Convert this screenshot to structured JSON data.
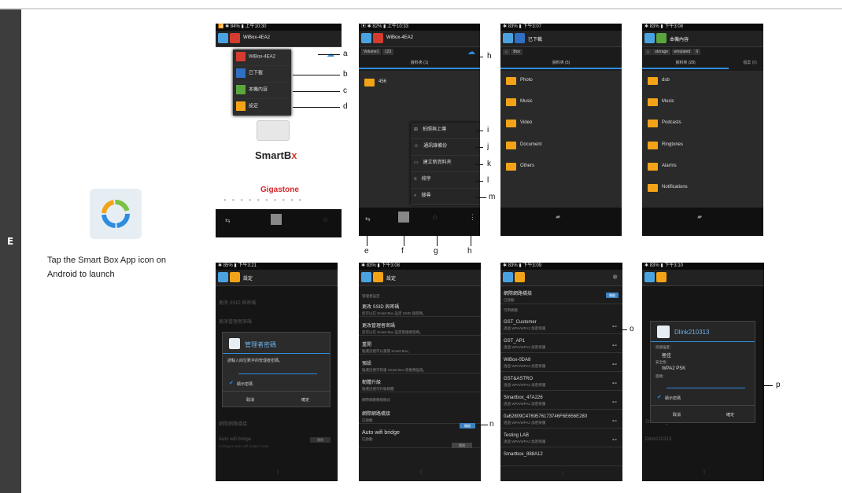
{
  "section_letter": "E",
  "caption": "Tap the Smart Box App icon on Android to launch",
  "s1": {
    "status": "📶 ✱ 84% ▮ 上午10:30",
    "title": "WiBox-4EA2",
    "menu": [
      "WiBox-4EA2",
      "已下載",
      "本機內容",
      "設定"
    ],
    "brand1": "SmartB",
    "brand2": "x",
    "brand3": "Gigastone"
  },
  "s2": {
    "status": "▣ ✱ 82% ▮ 上午10:33",
    "title": "WiBox-4EA2",
    "crumb1": "Volume1",
    "crumb2": "123",
    "tab": "資料夾 (1)",
    "folder": "456",
    "menu": [
      "拍照與上傳",
      "通訊錄備份",
      "建立新資料夾",
      "排序",
      "搜尋"
    ]
  },
  "s3": {
    "status": "✱ 83% ▮ 下午3:07",
    "title": "已下載",
    "crumb": "Box",
    "tab": "資料夾 (5)",
    "folders": [
      "Photo",
      "Music",
      "Video",
      "Document",
      "Others"
    ]
  },
  "s4": {
    "status": "✱ 83% ▮ 下午3:08",
    "title": "本機內容",
    "crumb1": "storage",
    "crumb2": "emulated",
    "crumb3": "0",
    "tab": "資料夾 (28)",
    "tab_right": "檔案 (0)",
    "folders": [
      "dsb",
      "Music",
      "Podcasts",
      "Ringtones",
      "Alarms",
      "Notifications"
    ]
  },
  "s5": {
    "status": "✱ 85% ▮ 下午3:21",
    "title": "設定",
    "bg_items": [
      "更改 SSID 與密碼",
      "更改管理者密碼",
      "網際網路橋接",
      "Auto wifi bridge"
    ],
    "bg_sub": "Configure auto wifi bridge mode",
    "dlg_title": "管理者密碼",
    "dlg_text": "請輸入四位數字的管理者密碼。",
    "checkbox": "顯示密碼",
    "cancel": "取消",
    "ok": "確定",
    "off": "關閉"
  },
  "s6": {
    "status": "✱ 83% ▮ 下午3:08",
    "title": "設定",
    "header": "管理者設定",
    "items": [
      {
        "t": "更改 SSID 與密碼",
        "s": "您可以在 Smart Box 設定 SSID 與密碼。"
      },
      {
        "t": "更改管理者密碼",
        "s": "您可以在 Smart Box 設定管理者密碼。"
      },
      {
        "t": "重開",
        "s": "點選這裡可以重開 Smart Box。"
      },
      {
        "t": "預設",
        "s": "點選這裡可恢復 Smart Box 原廠預設值。"
      },
      {
        "t": "韌體升級",
        "s": "點選這裡可升級韌體"
      }
    ],
    "section": "網際網路橋接模式",
    "bridge": "網際網路橋接",
    "bridge_sub": "已啟動",
    "auto": "Auto wifi bridge",
    "auto_sub": "已啟動",
    "on": "開啟",
    "off": "關閉"
  },
  "s7": {
    "status": "✱ 83% ▮ 下午3:09",
    "bridge": "網際網路橋接",
    "bridge_sub": "已啟動",
    "on": "開啟",
    "section": "可用網路",
    "sub": "透過 WPA/WPA2 加密保護",
    "networks": [
      "GST_Customer",
      "GST_AP1",
      "WiBox-0DA8",
      "GST&ASTRO",
      "Smartbox_47A226",
      "0a62809C4769576173746F6E656E280",
      "Testing LAB",
      "Smartbox_888A12"
    ]
  },
  "s8": {
    "status": "✱ 83% ▮ 下午3:10",
    "dlg_title": "Dlink210313",
    "l1": "訊號強度：",
    "v1": "極佳",
    "l2": "安全性：",
    "v2": "WPA2 PSK",
    "l3": "密碼：",
    "checkbox": "顯示密碼",
    "cancel": "取消",
    "ok": "確定",
    "bg": [
      "Smartbox_47A226",
      "Dlink210313"
    ]
  },
  "labels": [
    "a",
    "b",
    "c",
    "d",
    "e",
    "f",
    "g",
    "h",
    "h",
    "i",
    "j",
    "k",
    "l",
    "m",
    "n",
    "o",
    "p"
  ]
}
